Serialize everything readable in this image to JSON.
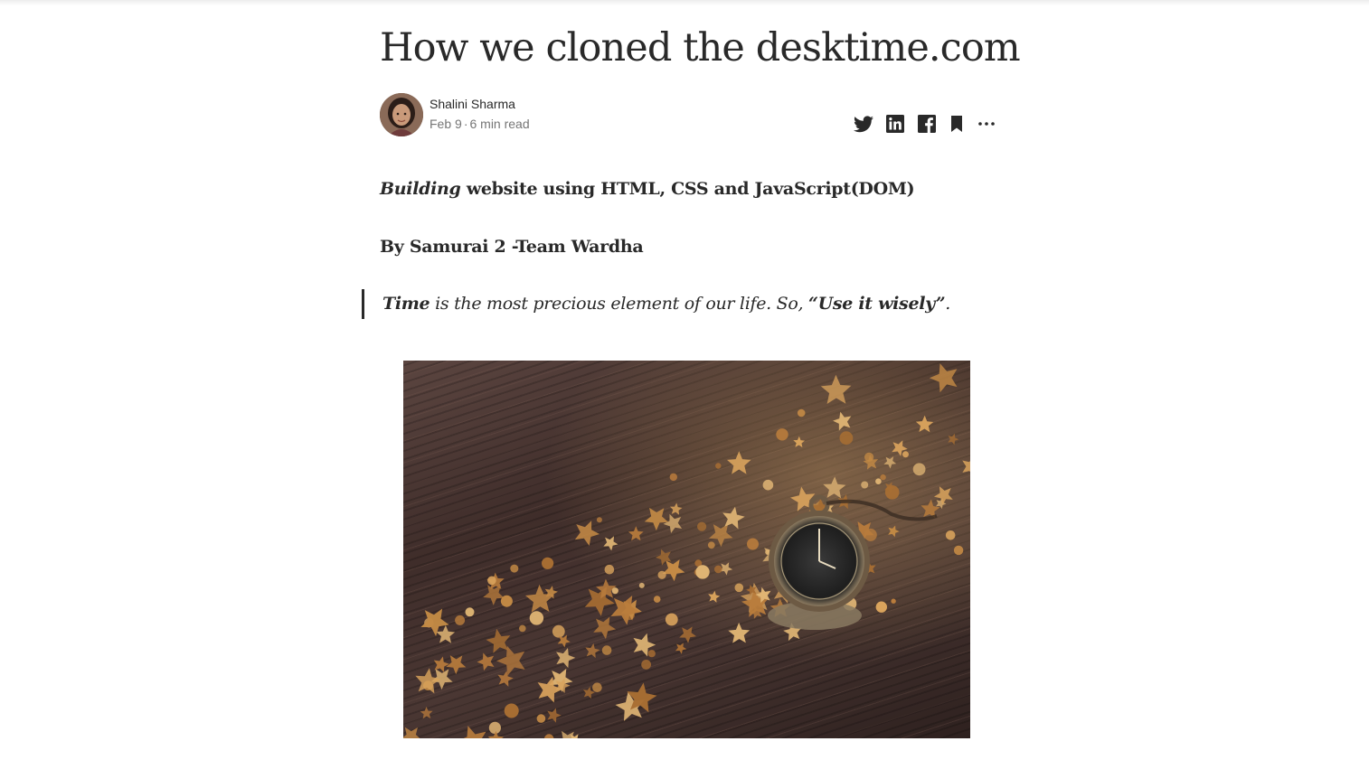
{
  "article": {
    "title": "How we cloned the desktime.com",
    "author": {
      "name": "Shalini Sharma",
      "date": "Feb 9",
      "separator": "·",
      "read_time": "6 min read"
    },
    "share_icons": [
      "twitter-icon",
      "linkedin-icon",
      "facebook-icon",
      "bookmark-icon",
      "more-icon"
    ],
    "subtitle": {
      "emphasis": "Building",
      "rest": " website using HTML, CSS and JavaScript(DOM)"
    },
    "byline": "By Samurai 2 -Team Wardha",
    "quote": {
      "lead": "Time",
      "middle": " is the most precious element of our life. So, ",
      "emphasis": "“Use it wisely”",
      "end": "."
    },
    "image": {
      "subject": "pocket watch with gold stars on wooden table"
    }
  },
  "colors": {
    "text": "#292929",
    "meta": "#757575",
    "icon": "#292929",
    "image_wood": "#3f2d2a",
    "image_stars": "#c48a45"
  }
}
